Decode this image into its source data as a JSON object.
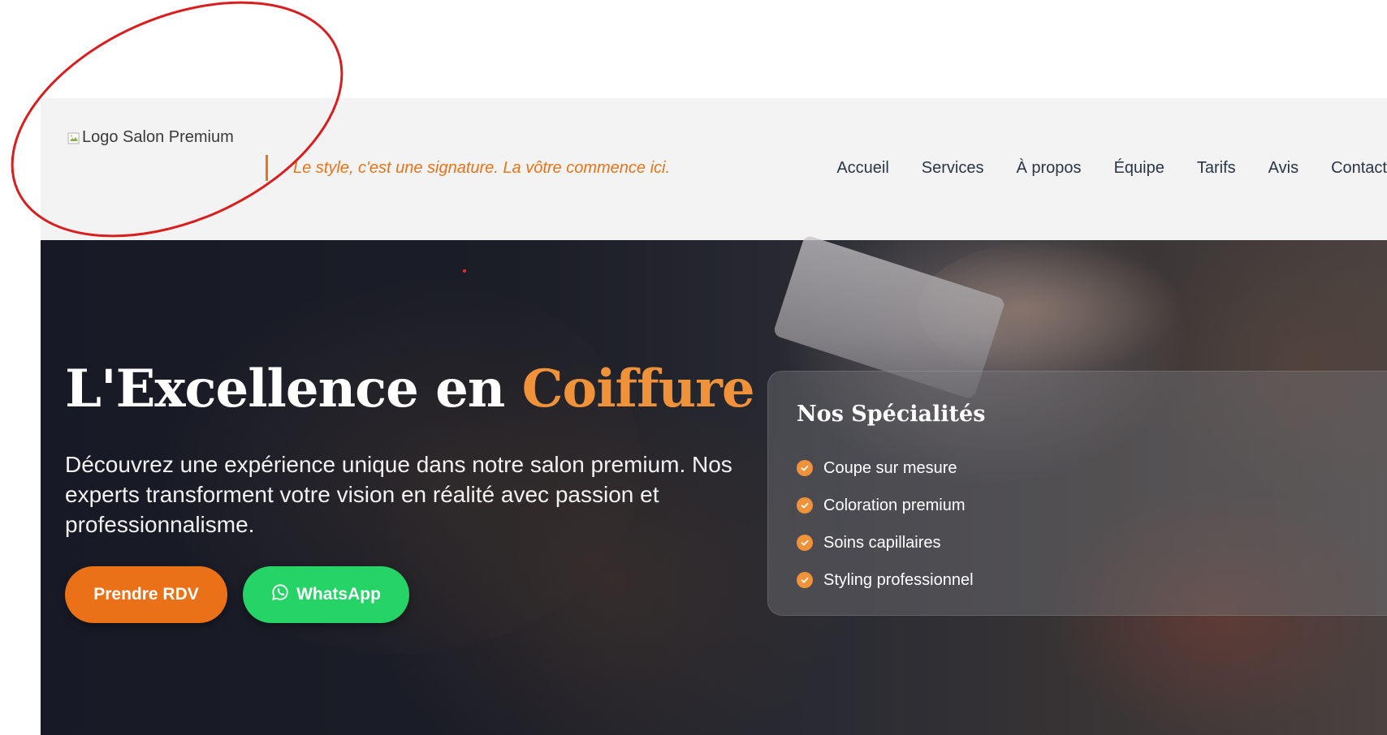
{
  "header": {
    "logo_alt": "Logo Salon Premium",
    "tagline": "Le style, c'est une signature. La vôtre commence ici.",
    "nav": [
      {
        "label": "Accueil"
      },
      {
        "label": "Services"
      },
      {
        "label": "À propos"
      },
      {
        "label": "Équipe"
      },
      {
        "label": "Tarifs"
      },
      {
        "label": "Avis"
      },
      {
        "label": "Contact"
      }
    ]
  },
  "hero": {
    "title_main": "L'Excellence en ",
    "title_accent": "Coiffure",
    "description": "Découvrez une expérience unique dans notre salon premium. Nos experts transforment votre vision en réalité avec passion et professionnalisme.",
    "buttons": {
      "appointment": "Prendre RDV",
      "whatsapp": "WhatsApp"
    },
    "specialties": {
      "title": "Nos Spécialités",
      "items": [
        {
          "label": "Coupe sur mesure",
          "icon": "check-circle-icon"
        },
        {
          "label": "Coloration premium",
          "icon": "check-circle-icon"
        },
        {
          "label": "Soins capillaires",
          "icon": "check-circle-icon"
        },
        {
          "label": "Styling professionnel",
          "icon": "check-circle-icon"
        }
      ]
    }
  },
  "colors": {
    "accent": "#ea7117",
    "accent_light": "#f0923a",
    "whatsapp": "#25d366",
    "header_bg": "#f3f3f3",
    "annotation": "#d81e1e"
  }
}
